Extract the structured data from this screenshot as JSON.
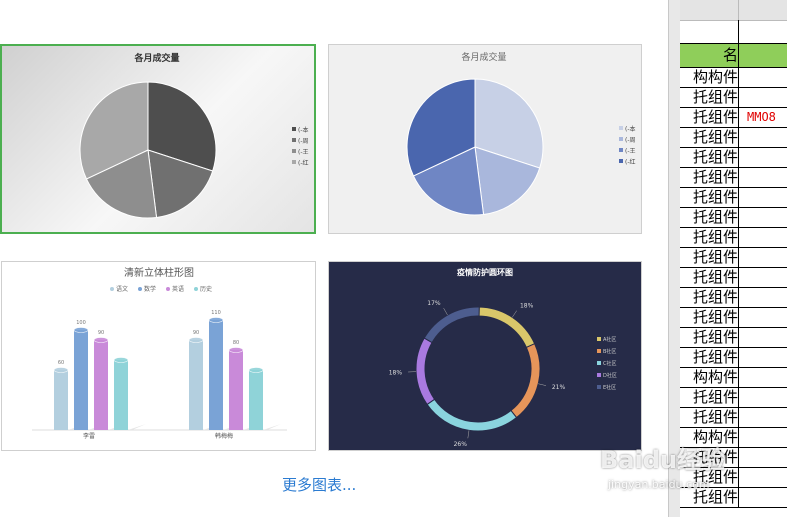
{
  "gallery": {
    "more_link": "更多图表...",
    "charts": [
      {
        "title": "各月成交量",
        "style": "grayscale-pie",
        "legend": [
          "(-本",
          "(-周",
          "(-王",
          "(-红"
        ],
        "chart_data": {
          "type": "pie",
          "values": [
            30,
            18,
            20,
            32
          ],
          "colors": [
            "#4e4e4e",
            "#707070",
            "#8e8e8e",
            "#a8a8a8"
          ]
        }
      },
      {
        "title": "各月成交量",
        "style": "blue-pie",
        "legend": [
          "(-本",
          "(-周",
          "(-王",
          "(-红"
        ],
        "chart_data": {
          "type": "pie",
          "values": [
            30,
            18,
            20,
            32
          ],
          "colors": [
            "#c7d0e6",
            "#a9b7dc",
            "#6f86c4",
            "#4a66ae"
          ]
        }
      },
      {
        "title": "清新立体柱形图",
        "style": "3d-bar",
        "legend": [
          "语文",
          "数学",
          "英语",
          "历史"
        ],
        "chart_data": {
          "type": "bar",
          "categories": [
            "李雷",
            "韩梅梅"
          ],
          "series": [
            {
              "name": "语文",
              "values": [
                60,
                90
              ],
              "color": "#b3cfdf"
            },
            {
              "name": "数学",
              "values": [
                100,
                110
              ],
              "color": "#7aa3d6"
            },
            {
              "name": "英语",
              "values": [
                90,
                80
              ],
              "color": "#c98ad9"
            },
            {
              "name": "历史",
              "values": [
                70,
                60
              ],
              "color": "#8fd3d8"
            }
          ],
          "value_labels": [
            [
              "60",
              "100",
              "90",
              ""
            ],
            [
              "90",
              "110",
              "80",
              ""
            ]
          ]
        }
      },
      {
        "title": "疫情防护圆环图",
        "style": "donut",
        "legend": [
          "A社区",
          "B社区",
          "C社区",
          "D社区",
          "E社区"
        ],
        "chart_data": {
          "type": "pie",
          "values": [
            18,
            21,
            26,
            18,
            17
          ],
          "labels": [
            "18%",
            "21%",
            "26%",
            "18%",
            "17%"
          ],
          "colors": [
            "#d9c76a",
            "#e6955a",
            "#8ad4de",
            "#a97ae0",
            "#4d5d8f"
          ]
        }
      }
    ]
  },
  "spreadsheet": {
    "header_fragment": "名",
    "rows": [
      {
        "a": "构构件",
        "b": ""
      },
      {
        "a": "托组件",
        "b": ""
      },
      {
        "a": "托组件",
        "b": "MMO8"
      },
      {
        "a": "托组件",
        "b": ""
      },
      {
        "a": "托组件",
        "b": ""
      },
      {
        "a": "托组件",
        "b": ""
      },
      {
        "a": "托组件",
        "b": ""
      },
      {
        "a": "托组件",
        "b": ""
      },
      {
        "a": "托组件",
        "b": ""
      },
      {
        "a": "托组件",
        "b": ""
      },
      {
        "a": "托组件",
        "b": ""
      },
      {
        "a": "托组件",
        "b": ""
      },
      {
        "a": "托组件",
        "b": ""
      },
      {
        "a": "托组件",
        "b": ""
      },
      {
        "a": "托组件",
        "b": ""
      },
      {
        "a": "构构件",
        "b": ""
      },
      {
        "a": "托组件",
        "b": ""
      },
      {
        "a": "托组件",
        "b": ""
      },
      {
        "a": "构构件",
        "b": ""
      },
      {
        "a": "托组件",
        "b": ""
      },
      {
        "a": "托组件",
        "b": ""
      },
      {
        "a": "托组件",
        "b": ""
      }
    ]
  },
  "watermark": {
    "logo": "Baidu经验",
    "url": "jingyan.baidu.com"
  }
}
